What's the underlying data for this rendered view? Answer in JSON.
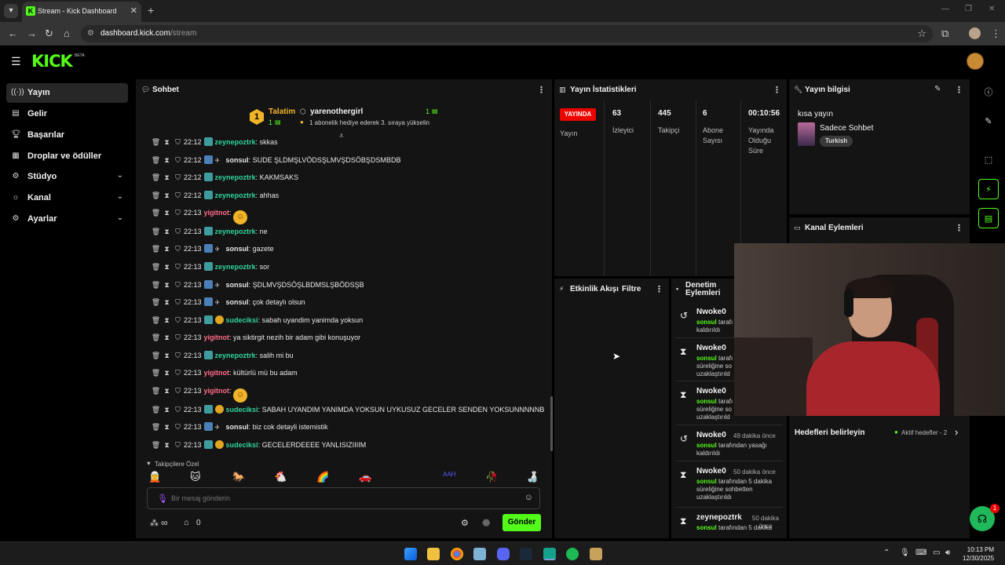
{
  "browser": {
    "tab_title": "Stream - Kick Dashboard",
    "url_domain": "dashboard.kick.com",
    "url_path": "/stream"
  },
  "header": {
    "logo": "KICK",
    "beta": "BETA"
  },
  "sidebar": {
    "items": [
      {
        "label": "Yayın",
        "icon": "broadcast-icon"
      },
      {
        "label": "Gelir",
        "icon": "revenue-icon"
      },
      {
        "label": "Başarılar",
        "icon": "trophy-icon"
      },
      {
        "label": "Droplar ve ödüller",
        "icon": "gift-icon"
      },
      {
        "label": "Stüdyo",
        "icon": "studio-icon"
      },
      {
        "label": "Kanal",
        "icon": "channel-icon"
      },
      {
        "label": "Ayarlar",
        "icon": "gear-icon"
      }
    ]
  },
  "chat": {
    "title": "Sohbet",
    "pinned": {
      "label": "Talatim",
      "count": "1",
      "user": "yarenothergirl",
      "user_count": "1",
      "text": "1 abonelik hediye ederek 3. sıraya yükselin"
    },
    "messages": [
      {
        "time": "22:12",
        "user": "zeynepoztrk",
        "text": "skkas",
        "color": "green",
        "badge": "sub"
      },
      {
        "time": "22:12",
        "user": "sonsul",
        "text": "SUDE ŞLDMŞLVÖDSŞLMVŞDSÖBŞDSMBDB",
        "color": "white",
        "badge": "bolt"
      },
      {
        "time": "22:12",
        "user": "zeynepoztrk",
        "text": "KAKMSAKS",
        "color": "green",
        "badge": "sub"
      },
      {
        "time": "22:12",
        "user": "zeynepoztrk",
        "text": "ahhas",
        "color": "green",
        "badge": "sub"
      },
      {
        "time": "22:13",
        "user": "yigitnot",
        "text": "",
        "color": "pink",
        "badge": "none",
        "emoji": true
      },
      {
        "time": "22:13",
        "user": "zeynepoztrk",
        "text": "ne",
        "color": "green",
        "badge": "sub"
      },
      {
        "time": "22:13",
        "user": "sonsul",
        "text": "gazete",
        "color": "white",
        "badge": "bolt"
      },
      {
        "time": "22:13",
        "user": "zeynepoztrk",
        "text": "sor",
        "color": "green",
        "badge": "sub"
      },
      {
        "time": "22:13",
        "user": "sonsul",
        "text": "ŞDLMVŞDSÖŞLBDMSLŞBÖDSŞB",
        "color": "white",
        "badge": "bolt"
      },
      {
        "time": "22:13",
        "user": "sonsul",
        "text": "çok detaylı olsun",
        "color": "white",
        "badge": "bolt"
      },
      {
        "time": "22:13",
        "user": "sudeciksi",
        "text": "sabah uyandim yanimda yoksun",
        "color": "green",
        "badge": "gold"
      },
      {
        "time": "22:13",
        "user": "yigitnot",
        "text": "ya siktirgit nezih bir adam gibi konuşuyor",
        "color": "pink",
        "badge": "none"
      },
      {
        "time": "22:13",
        "user": "zeynepoztrk",
        "text": "salih mi bu",
        "color": "green",
        "badge": "sub"
      },
      {
        "time": "22:13",
        "user": "yigitnot",
        "text": "kültürlü mü bu adam",
        "color": "pink",
        "badge": "none"
      },
      {
        "time": "22:13",
        "user": "yigitnot",
        "text": "",
        "color": "pink",
        "badge": "none",
        "emoji": true
      },
      {
        "time": "22:13",
        "user": "sudeciksi",
        "text": "SABAH UYANDIM YANIMDA YOKSUN UYKUSUZ GECELER SENDEN YOKSUNNNNNB",
        "color": "green",
        "badge": "gold"
      },
      {
        "time": "22:13",
        "user": "sonsul",
        "text": "biz cok detayli istemistik",
        "color": "white",
        "badge": "bolt"
      },
      {
        "time": "22:13",
        "user": "sudeciksi",
        "text": "GECELERDEEEE YANLISIZIIIIM",
        "color": "green",
        "badge": "gold"
      }
    ],
    "followers_label": "Takipçilere Özel",
    "input_placeholder": "Bir mesaj gönderin",
    "points": "∞",
    "gift_count": "0",
    "send_label": "Gönder"
  },
  "stats": {
    "title": "Yayın İstatistikleri",
    "live_label": "YAYINDA",
    "live_sub": "Yayın",
    "viewers_value": "63",
    "viewers_label": "İzleyici",
    "followers_value": "445",
    "followers_label": "Takipçi",
    "subs_value": "6",
    "subs_label_1": "Abone",
    "subs_label_2": "Sayısı",
    "uptime_value": "00:10:56",
    "uptime_label_1": "Yayında",
    "uptime_label_2": "Olduğu",
    "uptime_label_3": "Süre"
  },
  "stream_info": {
    "title": "Yayın bilgisi",
    "stream_title": "kısa yayın",
    "category": "Sadece Sohbet",
    "tag": "Turkish"
  },
  "channel_actions": {
    "title": "Kanal Eylemleri"
  },
  "activity": {
    "title": "Etkinlik Akışı",
    "filter": "Filtre"
  },
  "moderation": {
    "title_1": "Denetim",
    "title_2": "Eylemleri",
    "items": [
      {
        "user": "Nwoke0",
        "date": "",
        "line1_prefix": "sonsul",
        "line1": " tarafı",
        "line2": "kaldırıldı",
        "line3": "",
        "icon": "undo-icon"
      },
      {
        "user": "Nwoke0",
        "date": "",
        "line1_prefix": "sonsul",
        "line1": " tarafı",
        "line2": "süreliğine so",
        "line3": "uzaklaştırıld",
        "icon": "hourglass-icon"
      },
      {
        "user": "Nwoke0",
        "date": "",
        "line1_prefix": "sonsul",
        "line1": " tarafı",
        "line2": "süreliğine so",
        "line3": "uzaklaştırıld",
        "icon": "hourglass-icon"
      },
      {
        "user": "Nwoke0",
        "date": "49 dakika önce",
        "line1_prefix": "sonsul",
        "line1": " tarafından yasağı",
        "line2": "kaldırıldı",
        "line3": "",
        "icon": "undo-icon"
      },
      {
        "user": "Nwoke0",
        "date": "50 dakika önce",
        "line1_prefix": "sonsul",
        "line1": " tarafından 5 dakika",
        "line2": "süreliğine sohbetten",
        "line3": "uzaklaştırıldı",
        "icon": "hourglass-icon"
      },
      {
        "user": "zeynepoztrk",
        "date": "50 dakika önce",
        "line1_prefix": "sonsul",
        "line1": " tarafından 5 dakika",
        "line2": "",
        "line3": "",
        "icon": "hourglass-icon"
      }
    ]
  },
  "goals": {
    "title": "Hedefleri belirleyin",
    "active": "Aktif hedefler - 2"
  },
  "support": {
    "badge": "1"
  },
  "taskbar": {
    "time": "10:13 PM",
    "date": "12/30/2025"
  },
  "colors": {
    "accent": "#53fc18",
    "live": "#eb0400",
    "panel": "#141414"
  }
}
